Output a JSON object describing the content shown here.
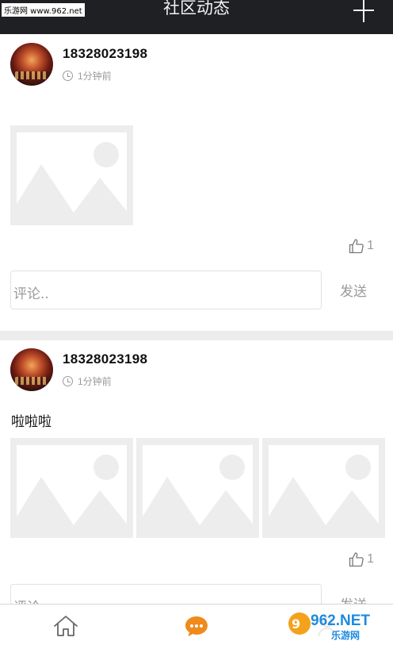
{
  "watermark_top": "乐游网 www.962.net",
  "header": {
    "title": "社区动态",
    "add_icon": "plus-icon"
  },
  "posts": [
    {
      "username": "18328023198",
      "time": "1分钟前",
      "text": "",
      "image_count": 1,
      "likes": "1",
      "comment_placeholder": "评论..",
      "send_label": "发送"
    },
    {
      "username": "18328023198",
      "time": "1分钟前",
      "text": "啦啦啦",
      "image_count": 3,
      "likes": "1",
      "comment_placeholder": "评论..",
      "send_label": "发送"
    }
  ],
  "tabbar": {
    "items": [
      {
        "icon": "home-icon",
        "active": false
      },
      {
        "icon": "chat-bubble-icon",
        "active": true
      },
      {
        "icon": "profile-icon",
        "active": false
      }
    ],
    "active_color": "#f08a1c",
    "inactive_color": "#666666"
  },
  "watermark_bottom": {
    "logo": "962.NET",
    "text": "乐游网"
  }
}
